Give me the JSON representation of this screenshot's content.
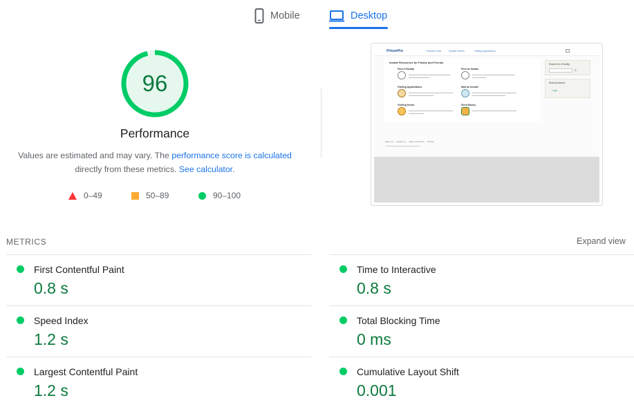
{
  "tabs": [
    {
      "label": "Mobile",
      "icon": "mobile-phone-icon",
      "active": false
    },
    {
      "label": "Desktop",
      "icon": "desktop-monitor-icon",
      "active": true
    }
  ],
  "score": {
    "value": "96",
    "fraction": 0.96,
    "title": "Performance",
    "desc_prefix": "Values are estimated and may vary. The ",
    "desc_link1": "performance score is calculated",
    "desc_middle": " directly from these metrics. ",
    "desc_link2": "See calculator",
    "desc_suffix": "."
  },
  "legend": {
    "fail": "0–49",
    "average": "50–89",
    "pass": "90–100"
  },
  "thumbnail": {
    "logo": "PrisonPro",
    "nav": [
      "Prisoner Lists",
      "Inmate Search",
      "Visiting Applications"
    ],
    "heading": "Inmate Resources for Family and Friends",
    "items": [
      {
        "title": "Find a Facility"
      },
      {
        "title": "Find an Inmate"
      },
      {
        "title": "Visiting Applications"
      },
      {
        "title": "Mail an Inmate"
      },
      {
        "title": "Visiting Hours"
      },
      {
        "title": "Send Money"
      }
    ],
    "side_titles": [
      "Search for a Facility",
      "Most Accessed"
    ],
    "side_link": "Login",
    "footer_links": [
      "About us",
      "Contact us",
      "Terms of Service",
      "Privacy"
    ]
  },
  "metrics": {
    "section_label": "METRICS",
    "expand_label": "Expand view",
    "items": [
      {
        "label": "First Contentful Paint",
        "value": "0.8 s",
        "status": "pass"
      },
      {
        "label": "Time to Interactive",
        "value": "0.8 s",
        "status": "pass"
      },
      {
        "label": "Speed Index",
        "value": "1.2 s",
        "status": "pass"
      },
      {
        "label": "Total Blocking Time",
        "value": "0 ms",
        "status": "pass"
      },
      {
        "label": "Largest Contentful Paint",
        "value": "1.2 s",
        "status": "pass"
      },
      {
        "label": "Cumulative Layout Shift",
        "value": "0.001",
        "status": "pass"
      }
    ]
  },
  "colors": {
    "pass": "#00cc66",
    "pass_text": "#0c7a3e",
    "average": "#ffaa33",
    "fail": "#ff3333",
    "accent": "#1a73e8"
  }
}
